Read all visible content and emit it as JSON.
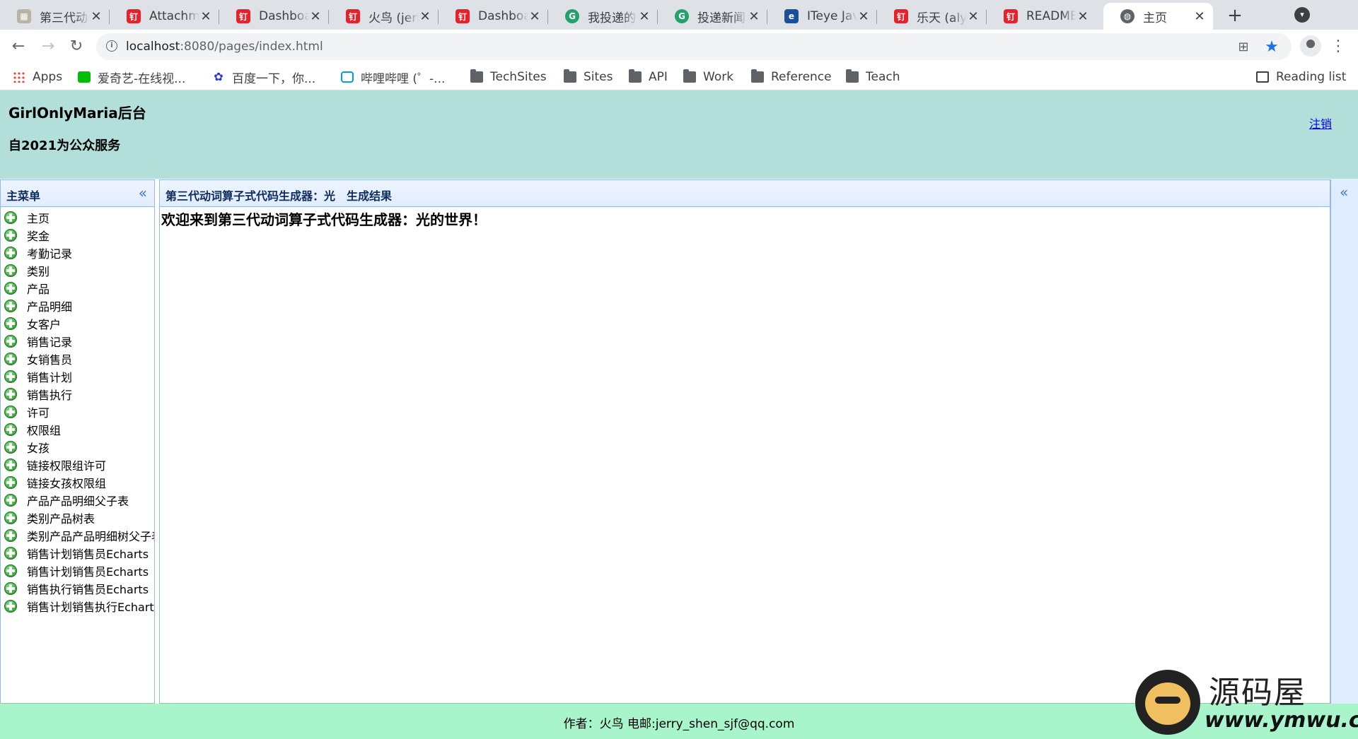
{
  "browser": {
    "tabs": [
      {
        "title": "第三代动",
        "icon": "image-icon",
        "active": false
      },
      {
        "title": "Attachme",
        "icon": "dingtalk-icon",
        "active": false
      },
      {
        "title": "Dashboa",
        "icon": "dingtalk-icon",
        "active": false
      },
      {
        "title": "火鸟 (jerr",
        "icon": "dingtalk-icon",
        "active": false
      },
      {
        "title": "Dashboa",
        "icon": "dingtalk-icon",
        "active": false
      },
      {
        "title": "我投递的",
        "icon": "gcode-icon",
        "active": false
      },
      {
        "title": "投递新闻",
        "icon": "gcode-icon",
        "active": false
      },
      {
        "title": "ITeye Jav",
        "icon": "iteye-icon",
        "active": false
      },
      {
        "title": "乐天 (aly",
        "icon": "dingtalk-icon",
        "active": false
      },
      {
        "title": "README",
        "icon": "dingtalk-icon",
        "active": false
      },
      {
        "title": "主页",
        "icon": "globe-icon",
        "active": true
      }
    ],
    "url_host": "localhost",
    "url_rest": ":8080/pages/index.html",
    "bookmarks": [
      {
        "label": "Apps",
        "icon": "apps-icon"
      },
      {
        "label": "爱奇艺-在线视...",
        "icon": "iqiyi-icon"
      },
      {
        "label": "百度一下，你...",
        "icon": "baidu-icon"
      },
      {
        "label": "哔哩哔哩 (゜-...",
        "icon": "bilibili-icon"
      },
      {
        "label": "TechSites",
        "icon": "folder-icon"
      },
      {
        "label": "Sites",
        "icon": "folder-icon"
      },
      {
        "label": "API",
        "icon": "folder-icon"
      },
      {
        "label": "Work",
        "icon": "folder-icon"
      },
      {
        "label": "Reference",
        "icon": "folder-icon"
      },
      {
        "label": "Teach",
        "icon": "folder-icon"
      }
    ],
    "reading_list": "Reading list"
  },
  "header": {
    "title": "GirlOnlyMaria后台",
    "subtitle": "自2021为公众服务",
    "logout": "注销"
  },
  "sidebar": {
    "title": "主菜单",
    "items": [
      "主页",
      "奖金",
      "考勤记录",
      "类别",
      "产品",
      "产品明细",
      "女客户",
      "销售记录",
      "女销售员",
      "销售计划",
      "销售执行",
      "许可",
      "权限组",
      "女孩",
      "链接权限组许可",
      "链接女孩权限组",
      "产品产品明细父子表",
      "类别产品树表",
      "类别产品产品明细树父子表",
      "销售计划销售员Echarts",
      "销售计划销售员Echarts",
      "销售执行销售员Echarts",
      "销售计划销售执行Echarts"
    ]
  },
  "main": {
    "title": "第三代动词算子式代码生成器：光　生成结果",
    "welcome": "欢迎来到第三代动词算子式代码生成器：光的世界！"
  },
  "footer": {
    "text": "作者：火鸟 电邮:jerry_shen_sjf@qq.com"
  },
  "watermark": {
    "name": "源码屋",
    "url": "www.ymwu.com"
  },
  "colors": {
    "header_bg": "#b3dfda",
    "footer_bg": "#a8f5cc",
    "panel_border": "#95b8e7",
    "panel_header": "#e0ecff",
    "link": "#0000ee"
  }
}
